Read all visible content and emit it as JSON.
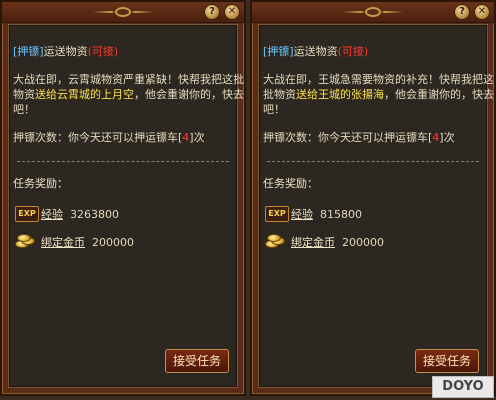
{
  "colors": {
    "panel_bg": "#5a2c17",
    "content_bg": "#2c2720",
    "tag_blue": "#6dc5ff",
    "tag_red": "#ff3a2a",
    "destination_yellow": "#ffe04d",
    "button_gold": "#c09048"
  },
  "window_buttons": {
    "help": "?",
    "close": "✕"
  },
  "panels": [
    {
      "tag_open": "[",
      "tag_name": "押镖",
      "tag_close": "]",
      "title": "运送物资",
      "status": "(可接)",
      "desc_line1": "大战在即，云霄城物资严重紧缺！快帮我把这批",
      "desc_line2_prefix": "物资",
      "desc_line2_dest": "送给云霄城的上月空",
      "desc_line2_suffix": "，他会重谢你的，快去",
      "desc_line3": "吧！",
      "escort_label": "押镖次数：",
      "escort_text": "你今天还可以押运镖车",
      "escort_count": "4",
      "escort_unit": "次",
      "reward_header": "任务奖励：",
      "exp_icon_text": "EXP",
      "exp_label": "经验",
      "exp_value": "3263800",
      "gold_label": "绑定金币",
      "gold_value": "200000",
      "accept_label": "接受任务"
    },
    {
      "tag_open": "[",
      "tag_name": "押镖",
      "tag_close": "]",
      "title": "运送物资",
      "status": "(可接)",
      "desc_line1": "大战在即，王城急需要物资的补充！快帮我把这",
      "desc_line2_prefix": "批物资",
      "desc_line2_dest": "送给王城的张揚海",
      "desc_line2_suffix": "，他会重谢你的，快去",
      "desc_line3": "吧！",
      "escort_label": "押镖次数：",
      "escort_text": "你今天还可以押运镖车",
      "escort_count": "4",
      "escort_unit": "次",
      "reward_header": "任务奖励：",
      "exp_icon_text": "EXP",
      "exp_label": "经验",
      "exp_value": "815800",
      "gold_label": "绑定金币",
      "gold_value": "200000",
      "accept_label": "接受任务"
    }
  ],
  "watermark": "DOYO"
}
